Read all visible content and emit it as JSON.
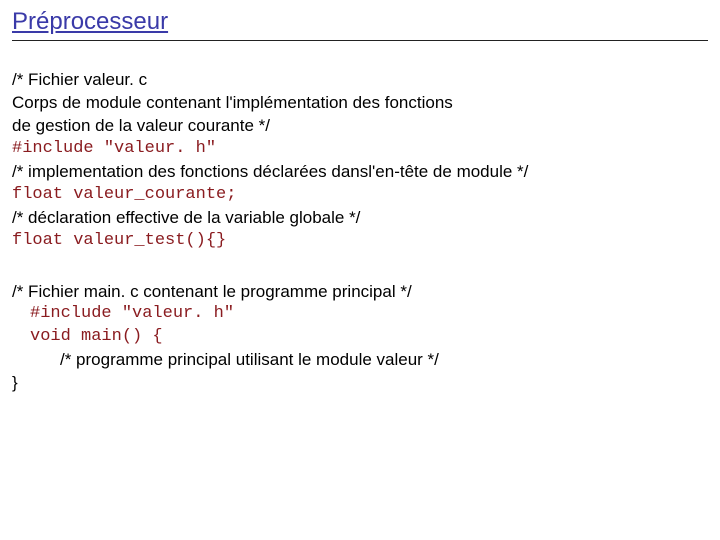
{
  "title": "Préprocesseur",
  "block1": {
    "l1": "/* Fichier valeur. c",
    "l2": "Corps de module contenant l'implémentation des fonctions",
    "l3": "de gestion de la valeur courante */",
    "l4": "#include \"valeur. h\"",
    "l5": "/* implementation des fonctions déclarées dansl'en-tête de module */",
    "l6": "float valeur_courante;",
    "l7": "/* déclaration effective de la variable globale */",
    "l8": "float valeur_test(){}"
  },
  "block2": {
    "l1": "/* Fichier main. c contenant le programme principal */",
    "l2": "#include \"valeur. h\"",
    "l3": "void main() {",
    "l4": "/* programme principal utilisant le module valeur */",
    "l5": "}"
  }
}
